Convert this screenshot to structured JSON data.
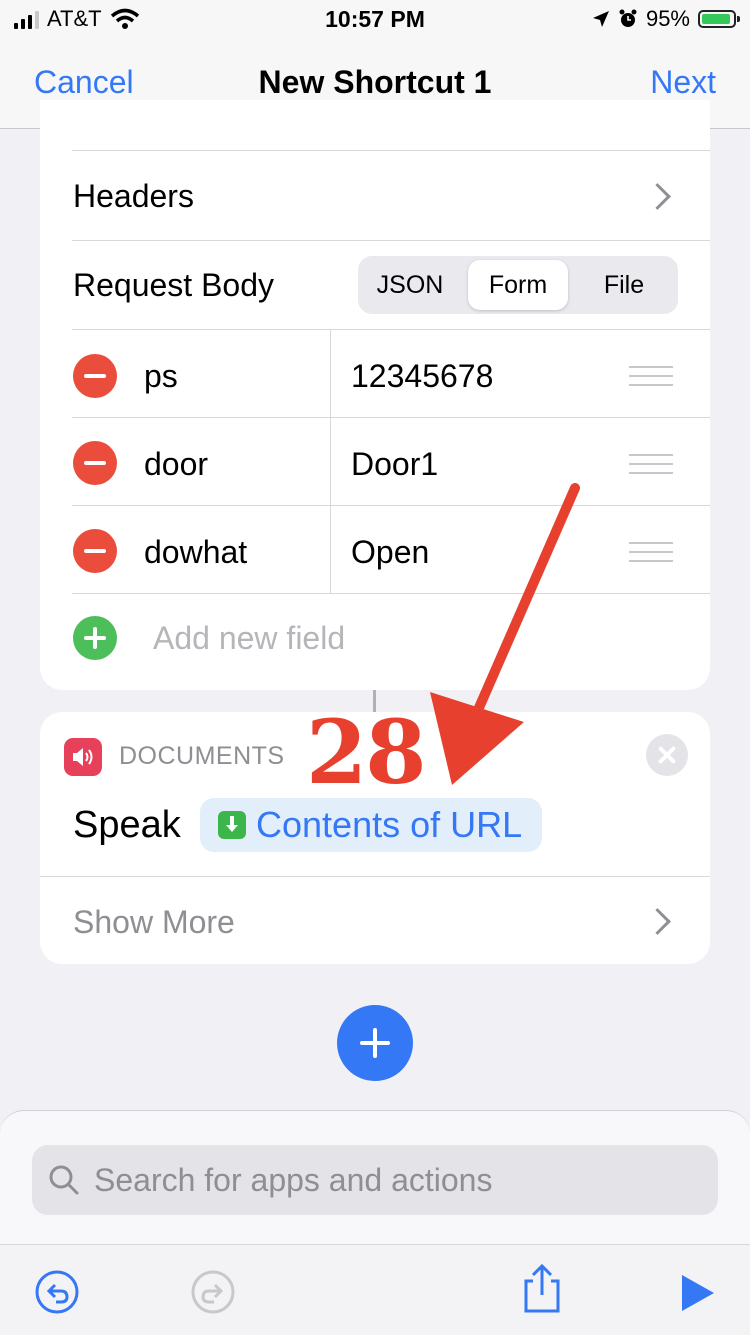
{
  "status": {
    "carrier": "AT&T",
    "time": "10:57 PM",
    "battery": "95%"
  },
  "nav": {
    "cancel": "Cancel",
    "title": "New Shortcut 1",
    "next": "Next"
  },
  "request": {
    "headers_label": "Headers",
    "body_label": "Request Body",
    "body_options": [
      "JSON",
      "Form",
      "File"
    ],
    "body_selected": "Form",
    "fields": [
      {
        "key": "ps",
        "value": "12345678"
      },
      {
        "key": "door",
        "value": "Door1"
      },
      {
        "key": "dowhat",
        "value": "Open"
      }
    ],
    "add_field": "Add new field"
  },
  "speak_action": {
    "category": "DOCUMENTS",
    "verb": "Speak",
    "token": "Contents of URL",
    "show_more": "Show More"
  },
  "search": {
    "placeholder": "Search for apps and actions"
  },
  "annotation": {
    "step": "28"
  },
  "icons": [
    "signal-icon",
    "wifi-icon",
    "location-icon",
    "alarm-icon",
    "battery-icon",
    "chevron-right-icon",
    "remove-icon",
    "drag-handle-icon",
    "add-field-icon",
    "speaker-icon",
    "close-icon",
    "download-icon",
    "add-action-icon",
    "search-icon",
    "undo-icon",
    "redo-icon",
    "share-icon",
    "play-icon"
  ],
  "colors": {
    "accent": "#3478f6",
    "destructive": "#eb4d3d",
    "add": "#4cbe5a",
    "annotation": "#e8402e"
  }
}
